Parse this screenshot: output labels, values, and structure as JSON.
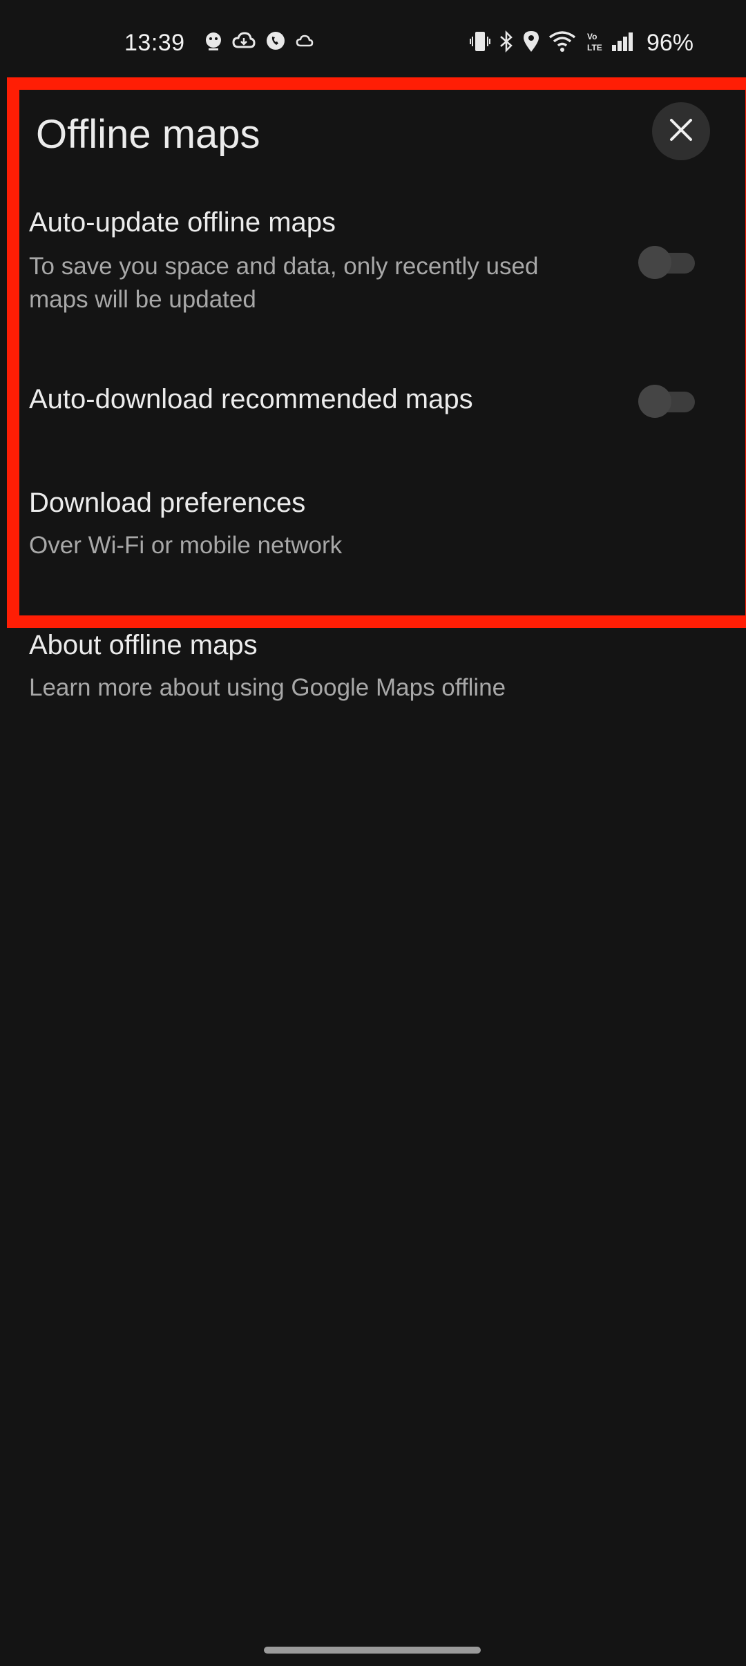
{
  "status_bar": {
    "time": "13:39",
    "battery": "96%",
    "left_icons": [
      "app-notification-icon",
      "cloud-download-icon",
      "phone-call-icon",
      "cloud-outline-icon"
    ],
    "right_icons": [
      "vibrate-icon",
      "bluetooth-icon",
      "location-icon",
      "wifi-icon",
      "volte-icon",
      "signal-icon"
    ]
  },
  "header": {
    "title": "Offline maps",
    "close_icon": "close-icon"
  },
  "settings": {
    "auto_update": {
      "title": "Auto-update offline maps",
      "subtitle_line1": "To save you space and data, only recently used",
      "subtitle_line2": "maps will be updated",
      "enabled": false
    },
    "auto_download": {
      "title": "Auto-download recommended maps",
      "enabled": false
    },
    "download_preferences": {
      "title": "Download preferences",
      "subtitle": "Over Wi-Fi or mobile network"
    },
    "about": {
      "title": "About offline maps",
      "subtitle": "Learn more about using Google Maps offline"
    }
  },
  "colors": {
    "background": "#141414",
    "highlight": "#ff1e05",
    "toggle_off": "#454545"
  }
}
